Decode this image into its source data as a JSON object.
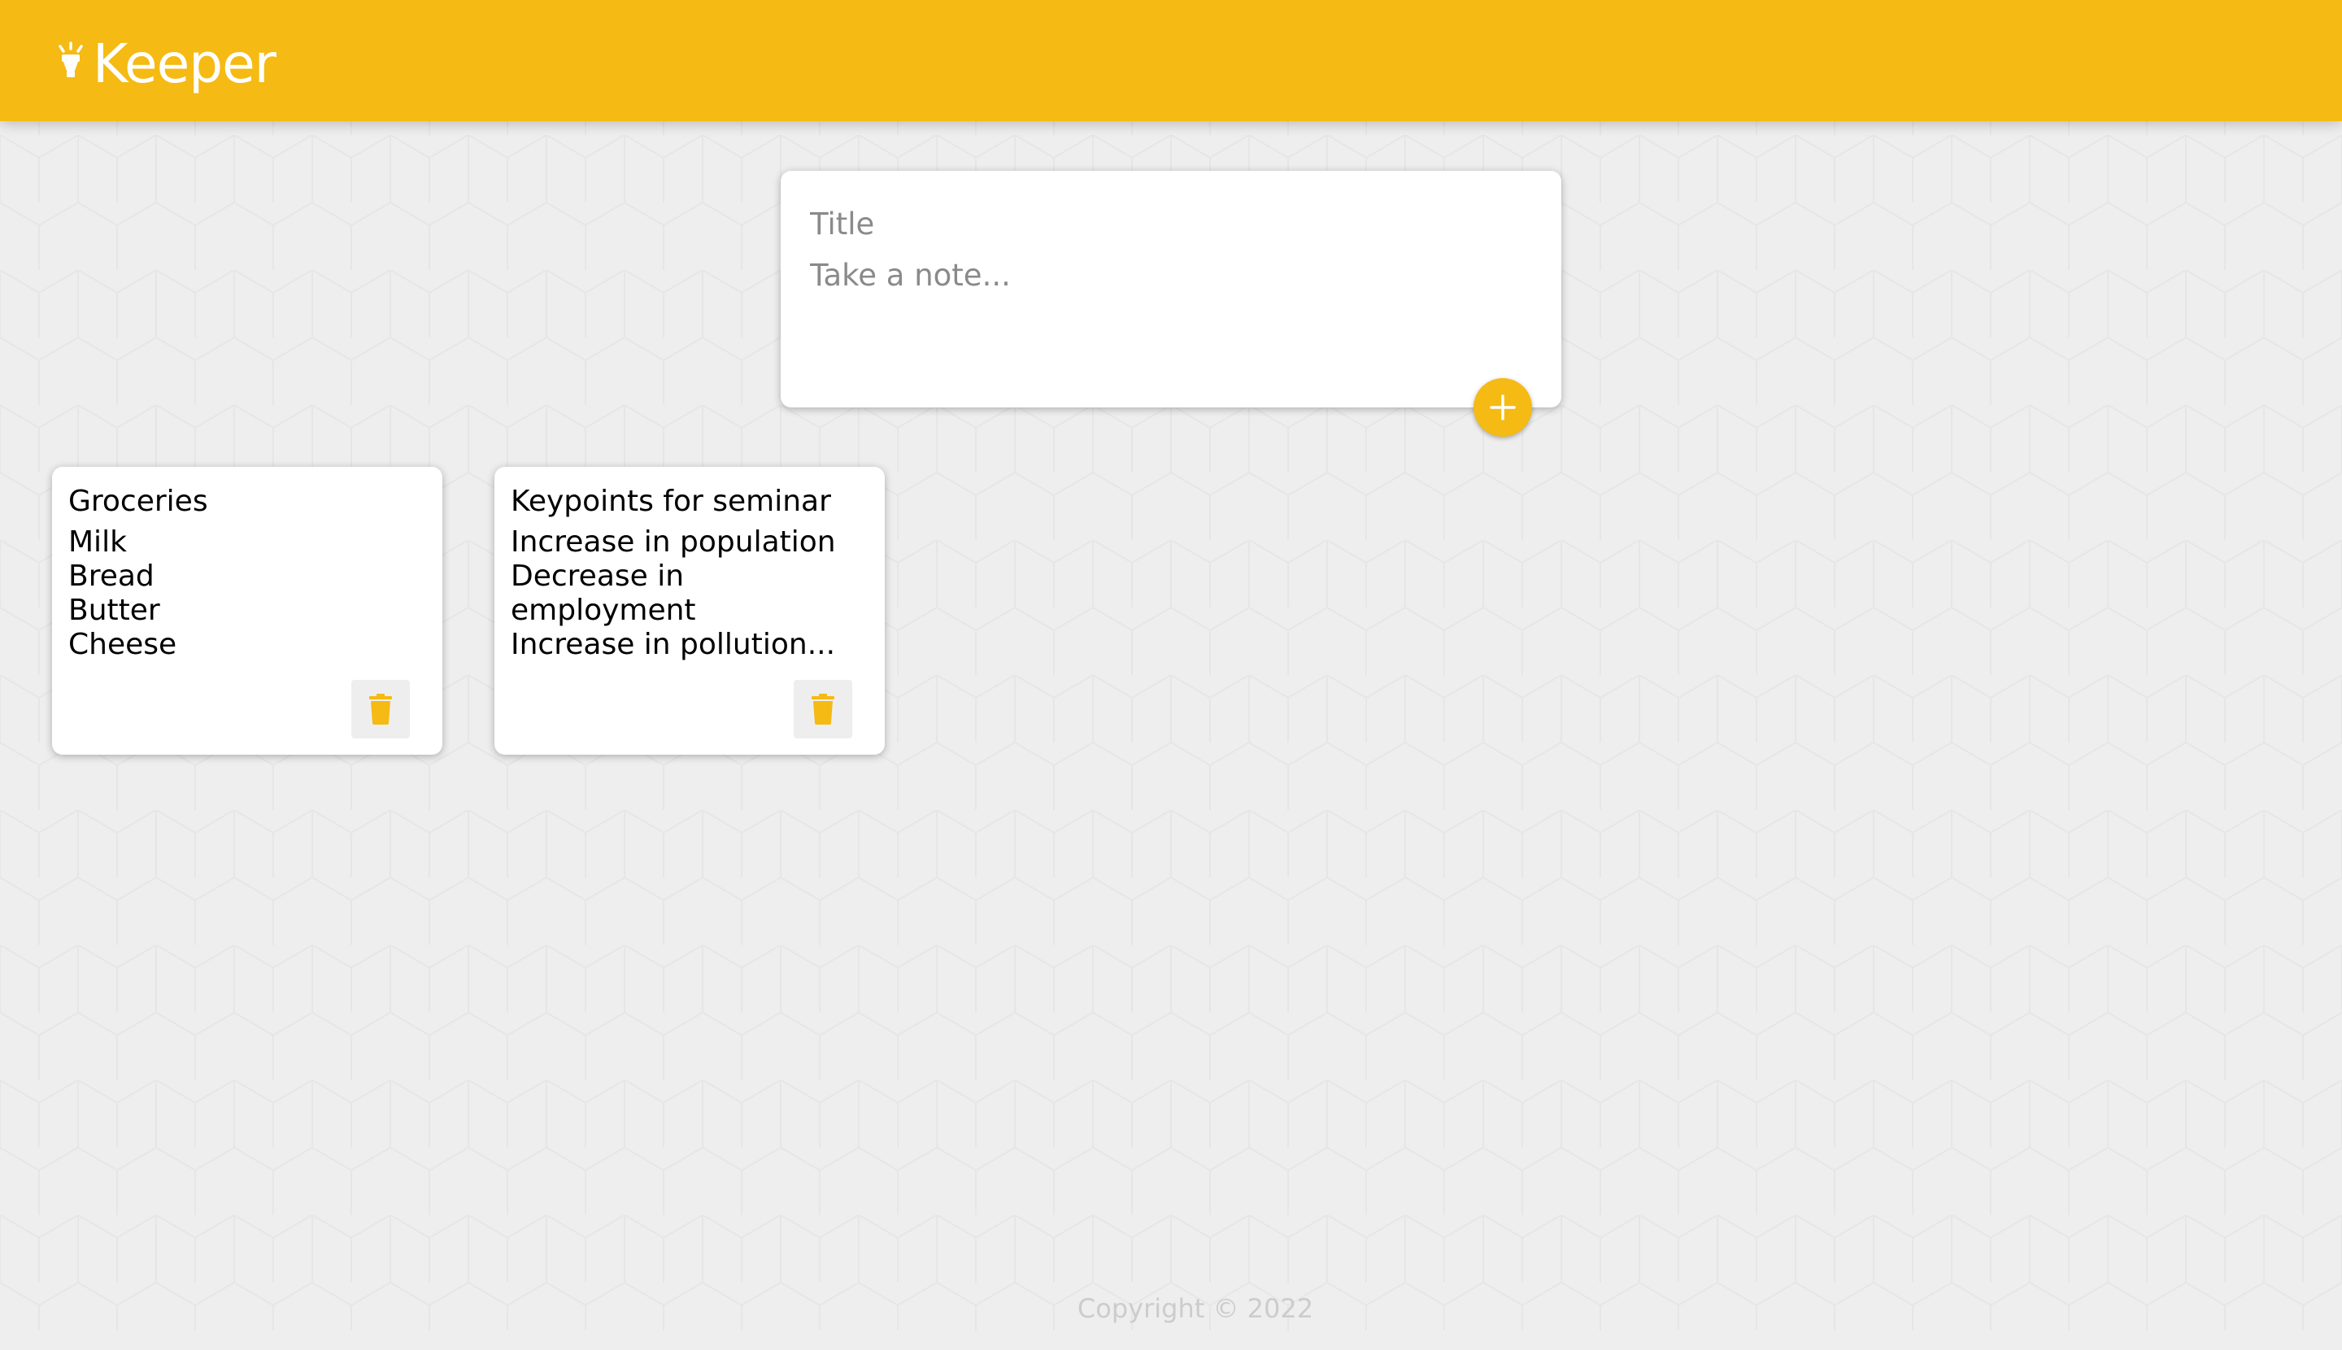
{
  "app": {
    "name": "Keeper",
    "accent_color": "#f5ba13",
    "background_color": "#eeeeee",
    "logo_icon": "lightbulb-icon"
  },
  "create_note": {
    "title_placeholder": "Title",
    "content_placeholder": "Take a note...",
    "add_icon": "plus-icon"
  },
  "notes": [
    {
      "title": "Groceries",
      "content": "Milk\nBread\nButter\nCheese",
      "delete_icon": "trash-icon"
    },
    {
      "title": "Keypoints for seminar",
      "content": "Increase in population\nDecrease in\nemployment\nIncrease in pollution...",
      "delete_icon": "trash-icon"
    }
  ],
  "footer": {
    "copyright": "Copyright © 2022"
  }
}
